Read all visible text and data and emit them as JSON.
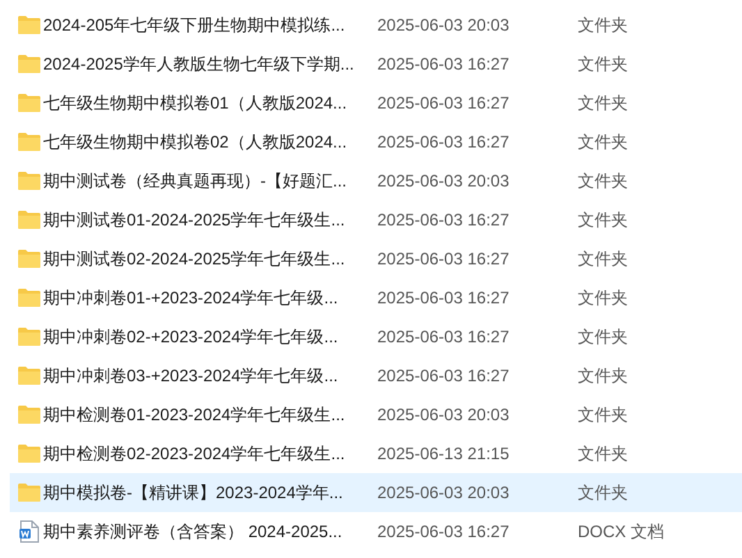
{
  "files": [
    {
      "kind": "folder",
      "name": "2024-205年七年级下册生物期中模拟练...",
      "modified": "2025-06-03 20:03",
      "type": "文件夹",
      "selected": false
    },
    {
      "kind": "folder",
      "name": "2024-2025学年人教版生物七年级下学期...",
      "modified": "2025-06-03 16:27",
      "type": "文件夹",
      "selected": false
    },
    {
      "kind": "folder",
      "name": "七年级生物期中模拟卷01（人教版2024...",
      "modified": "2025-06-03 16:27",
      "type": "文件夹",
      "selected": false
    },
    {
      "kind": "folder",
      "name": "七年级生物期中模拟卷02（人教版2024...",
      "modified": "2025-06-03 16:27",
      "type": "文件夹",
      "selected": false
    },
    {
      "kind": "folder",
      "name": "期中测试卷（经典真题再现）-【好题汇...",
      "modified": "2025-06-03 20:03",
      "type": "文件夹",
      "selected": false
    },
    {
      "kind": "folder",
      "name": "期中测试卷01-2024-2025学年七年级生...",
      "modified": "2025-06-03 16:27",
      "type": "文件夹",
      "selected": false
    },
    {
      "kind": "folder",
      "name": "期中测试卷02-2024-2025学年七年级生...",
      "modified": "2025-06-03 16:27",
      "type": "文件夹",
      "selected": false
    },
    {
      "kind": "folder",
      "name": "期中冲刺卷01-+2023-2024学年七年级...",
      "modified": "2025-06-03 16:27",
      "type": "文件夹",
      "selected": false
    },
    {
      "kind": "folder",
      "name": "期中冲刺卷02-+2023-2024学年七年级...",
      "modified": "2025-06-03 16:27",
      "type": "文件夹",
      "selected": false
    },
    {
      "kind": "folder",
      "name": "期中冲刺卷03-+2023-2024学年七年级...",
      "modified": "2025-06-03 16:27",
      "type": "文件夹",
      "selected": false
    },
    {
      "kind": "folder",
      "name": "期中检测卷01-2023-2024学年七年级生...",
      "modified": "2025-06-03 20:03",
      "type": "文件夹",
      "selected": false
    },
    {
      "kind": "folder",
      "name": "期中检测卷02-2023-2024学年七年级生...",
      "modified": "2025-06-13 21:15",
      "type": "文件夹",
      "selected": false
    },
    {
      "kind": "folder",
      "name": "期中模拟卷-【精讲课】2023-2024学年...",
      "modified": "2025-06-03 20:03",
      "type": "文件夹",
      "selected": true
    },
    {
      "kind": "docx",
      "name": "期中素养测评卷（含答案） 2024-2025...",
      "modified": "2025-06-03 16:27",
      "type": "DOCX 文档",
      "selected": false
    }
  ]
}
